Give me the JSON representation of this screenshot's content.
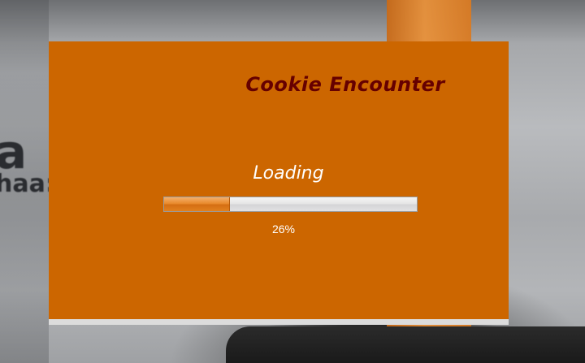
{
  "game": {
    "title": "Cookie Encounter"
  },
  "loading": {
    "label": "Loading",
    "progress_fraction": 0.26,
    "progress_text": "26%"
  },
  "background": {
    "partial_text_line1": "a",
    "partial_text_line2": "haa:"
  },
  "colors": {
    "panel": "#cc6600",
    "title": "#660000",
    "progress_fill": "#e98a2c",
    "progress_track": "#e6e6e6",
    "text": "#ffffff"
  }
}
